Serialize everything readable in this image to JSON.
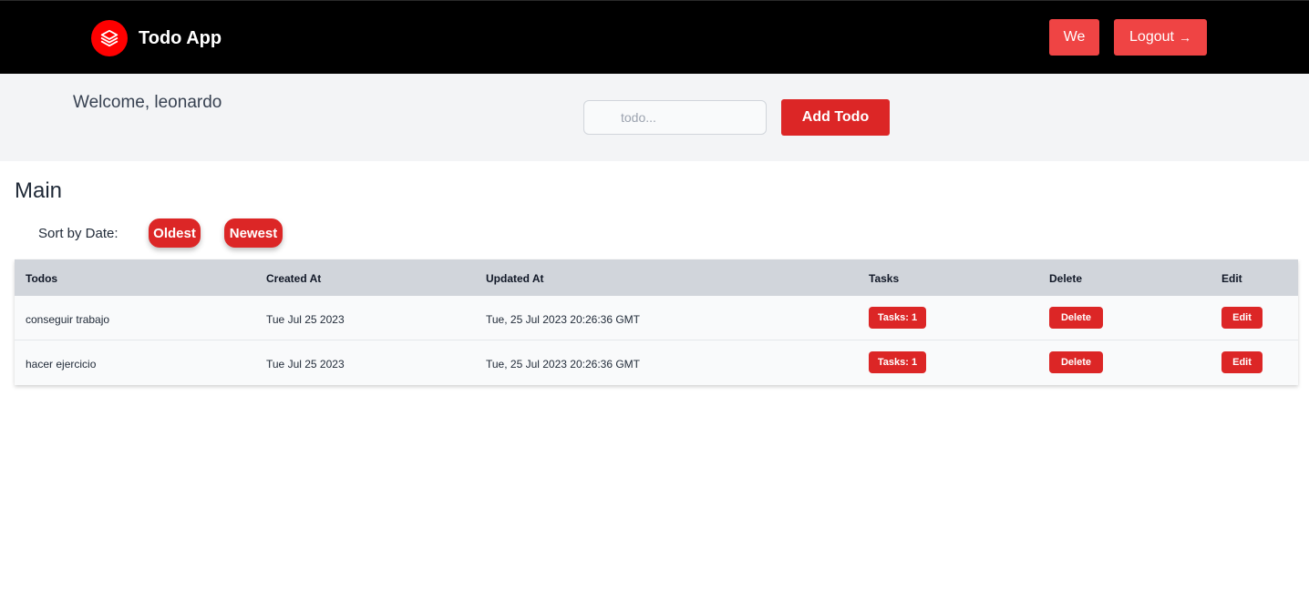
{
  "header": {
    "app_name": "Todo App",
    "logo_icon": "stack-layers-icon",
    "user_button_label": "We",
    "logout_label": "Logout",
    "logout_icon": "arrow-right-icon",
    "brand_color": "#ff0000",
    "accent_color": "#ef4444"
  },
  "subheader": {
    "welcome_text": "Welcome, leonardo",
    "todo_input": {
      "placeholder": "todo...",
      "value": ""
    },
    "add_button_label": "Add Todo"
  },
  "main": {
    "title": "Main",
    "sort_label": "Sort by Date:",
    "sort_oldest_label": "Oldest",
    "sort_newest_label": "Newest"
  },
  "table": {
    "columns": [
      "Todos",
      "Created At",
      "Updated At",
      "Tasks",
      "Delete",
      "Edit"
    ],
    "rows": [
      {
        "todo": "conseguir trabajo",
        "created_at": "Tue Jul 25 2023",
        "updated_at": "Tue, 25 Jul 2023 20:26:36 GMT",
        "tasks_label": "Tasks: 1",
        "delete_label": "Delete",
        "edit_label": "Edit"
      },
      {
        "todo": "hacer ejercicio",
        "created_at": "Tue Jul 25 2023",
        "updated_at": "Tue, 25 Jul 2023 20:26:36 GMT",
        "tasks_label": "Tasks: 1",
        "delete_label": "Delete",
        "edit_label": "Edit"
      }
    ]
  }
}
